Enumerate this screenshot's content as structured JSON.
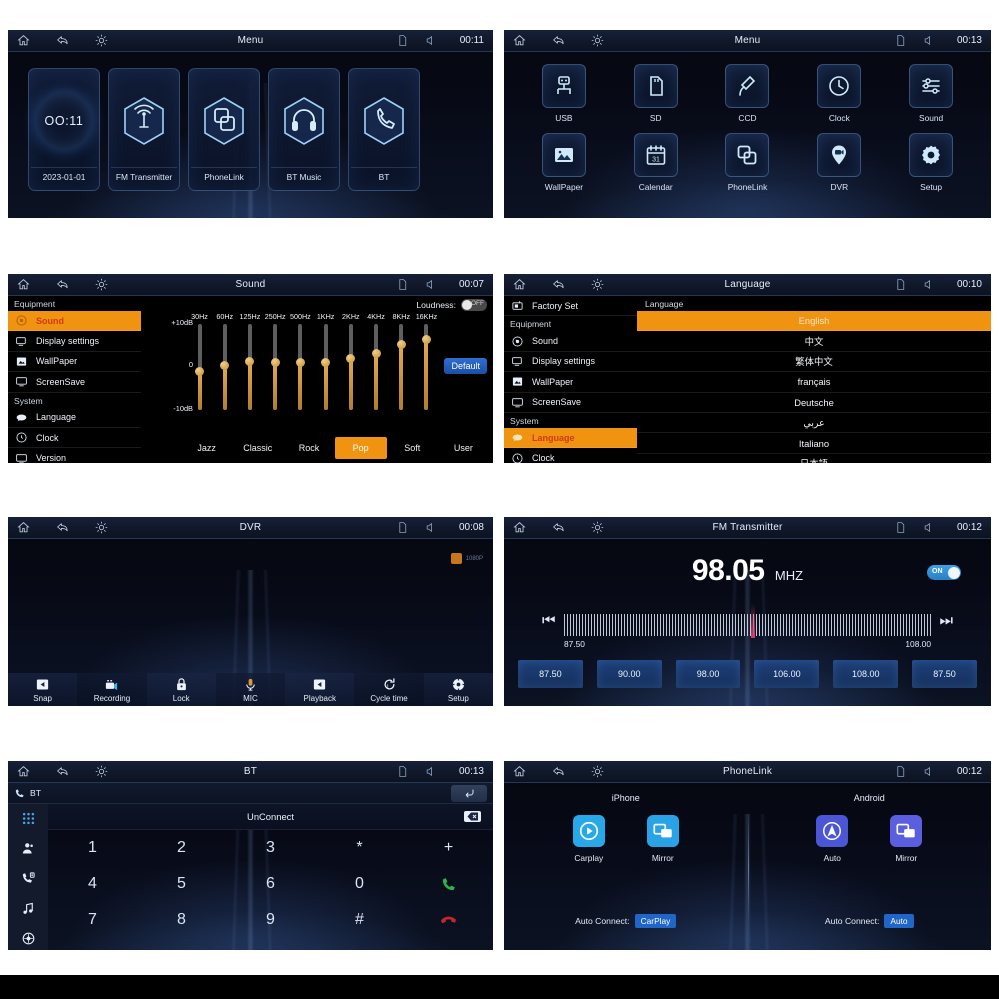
{
  "statusbar": {
    "icons": [
      "home-icon",
      "back-icon",
      "brightness-icon",
      "sd-card-icon",
      "mute-icon"
    ],
    "titles": {
      "menu1": "Menu",
      "menu2": "Menu",
      "sound": "Sound",
      "language": "Language",
      "dvr": "DVR",
      "fm": "FM Transmitter",
      "bt": "BT",
      "phonelink": "PhoneLink"
    },
    "times": {
      "menu1": "00:11",
      "menu2": "00:13",
      "sound": "00:07",
      "language": "00:10",
      "dvr": "00:08",
      "fm": "00:12",
      "bt": "00:13",
      "phonelink": "00:12"
    }
  },
  "menu_carousel": {
    "clock_time": "OO:11",
    "cards": [
      {
        "label": "2023-01-01",
        "icon": "clock-globe-icon"
      },
      {
        "label": "FM Transmitter",
        "icon": "antenna-icon"
      },
      {
        "label": "PhoneLink",
        "icon": "phonelink-icon"
      },
      {
        "label": "BT Music",
        "icon": "headphones-icon"
      },
      {
        "label": "BT",
        "icon": "phone-icon"
      }
    ]
  },
  "app_grid": {
    "apps": [
      {
        "label": "USB",
        "icon": "usb-icon"
      },
      {
        "label": "SD",
        "icon": "sd-card-icon"
      },
      {
        "label": "CCD",
        "icon": "camera-plug-icon"
      },
      {
        "label": "Clock",
        "icon": "clock-icon"
      },
      {
        "label": "Sound",
        "icon": "sliders-icon"
      },
      {
        "label": "WallPaper",
        "icon": "image-icon"
      },
      {
        "label": "Calendar",
        "icon": "calendar-icon"
      },
      {
        "label": "PhoneLink",
        "icon": "phonelink-icon"
      },
      {
        "label": "DVR",
        "icon": "location-camera-icon"
      },
      {
        "label": "Setup",
        "icon": "gear-icon"
      }
    ]
  },
  "settings_sidebar_sound": {
    "groups": [
      {
        "title": "Equipment",
        "items": [
          {
            "label": "Sound",
            "icon": "sound-icon",
            "active": true
          },
          {
            "label": "Display settings",
            "icon": "display-icon",
            "active": false
          },
          {
            "label": "WallPaper",
            "icon": "wallpaper-icon",
            "active": false
          },
          {
            "label": "ScreenSave",
            "icon": "screensave-icon",
            "active": false
          }
        ]
      },
      {
        "title": "System",
        "items": [
          {
            "label": "Language",
            "icon": "language-icon",
            "active": false
          },
          {
            "label": "Clock",
            "icon": "clock-icon",
            "active": false
          },
          {
            "label": "Version",
            "icon": "version-icon",
            "active": false
          }
        ]
      }
    ]
  },
  "settings_sidebar_language": {
    "top_item": {
      "label": "Factory Set",
      "icon": "factory-icon"
    },
    "groups": [
      {
        "title": "Equipment",
        "items": [
          {
            "label": "Sound",
            "icon": "sound-icon",
            "active": false
          },
          {
            "label": "Display settings",
            "icon": "display-icon",
            "active": false
          },
          {
            "label": "WallPaper",
            "icon": "wallpaper-icon",
            "active": false
          },
          {
            "label": "ScreenSave",
            "icon": "screensave-icon",
            "active": false
          }
        ]
      },
      {
        "title": "System",
        "items": [
          {
            "label": "Language",
            "icon": "language-icon",
            "active": true
          },
          {
            "label": "Clock",
            "icon": "clock-icon",
            "active": false
          }
        ]
      }
    ]
  },
  "equalizer": {
    "loudness_label": "Loudness:",
    "loudness_state": "OFF",
    "default_button": "Default",
    "scale": {
      "top": "+10dB",
      "mid": "0",
      "bottom": "-10dB"
    },
    "presets": [
      "Jazz",
      "Classic",
      "Rock",
      "Pop",
      "Soft",
      "User"
    ],
    "active_preset": "Pop",
    "bands": [
      {
        "hz": "30Hz",
        "db": -4
      },
      {
        "hz": "60Hz",
        "db": -1
      },
      {
        "hz": "125Hz",
        "db": 0
      },
      {
        "hz": "250Hz",
        "db": 0
      },
      {
        "hz": "500Hz",
        "db": 0
      },
      {
        "hz": "1KHz",
        "db": 0
      },
      {
        "hz": "2KHz",
        "db": 1
      },
      {
        "hz": "4KHz",
        "db": 2
      },
      {
        "hz": "8KHz",
        "db": 4
      },
      {
        "hz": "16KHz",
        "db": 5
      }
    ]
  },
  "language_panel": {
    "header": "Language",
    "options": [
      "English",
      "中文",
      "繁体中文",
      "français",
      "Deutsche",
      "عربي",
      "Italiano",
      "日本語"
    ],
    "selected": "English"
  },
  "dvr": {
    "badge_resolution": "1080P",
    "buttons": [
      {
        "label": "Snap",
        "icon": "snap-icon"
      },
      {
        "label": "Recording",
        "icon": "record-camera-icon"
      },
      {
        "label": "Lock",
        "icon": "lock-icon"
      },
      {
        "label": "MIC",
        "icon": "microphone-icon"
      },
      {
        "label": "Playback",
        "icon": "playback-icon"
      },
      {
        "label": "Cycle time",
        "icon": "cycle-time-icon"
      },
      {
        "label": "Setup",
        "icon": "gear-icon"
      }
    ]
  },
  "fm": {
    "frequency": "98.05",
    "unit": "MHZ",
    "toggle_state": "ON",
    "range_min": "87.50",
    "range_max": "108.00",
    "prev_icon": "skip-previous-icon",
    "next_icon": "skip-next-icon",
    "presets": [
      "87.50",
      "90.00",
      "98.00",
      "106.00",
      "108.00",
      "87.50"
    ]
  },
  "bt": {
    "sub_title": "BT",
    "sub_icon": "bt-phone-icon",
    "back_icon": "return-icon",
    "display_text": "UnConnect",
    "delete_icon": "backspace-icon",
    "rail_icons": [
      "keypad-icon",
      "contacts-icon",
      "call-log-icon",
      "music-note-icon",
      "settings-icon"
    ],
    "keys": [
      "1",
      "2",
      "3",
      "*",
      "+",
      "4",
      "5",
      "6",
      "0",
      "call-icon",
      "7",
      "8",
      "9",
      "#",
      "hangup-icon"
    ]
  },
  "phonelink": {
    "columns": [
      {
        "header": "iPhone",
        "apps": [
          {
            "label": "Carplay",
            "icon": "carplay-icon",
            "color": "#28a8e8"
          },
          {
            "label": "Mirror",
            "icon": "mirror-icon",
            "color": "#29a3e6"
          }
        ],
        "auto_label": "Auto Connect:",
        "auto_value": "CarPlay"
      },
      {
        "header": "Android",
        "apps": [
          {
            "label": "Auto",
            "icon": "android-auto-icon",
            "color": "#4a56d6"
          },
          {
            "label": "Mirror",
            "icon": "mirror-icon",
            "color": "#5a5fe0"
          }
        ],
        "auto_label": "Auto Connect:",
        "auto_value": "Auto"
      }
    ]
  },
  "colors": {
    "accent_orange": "#ef9310",
    "accent_blue": "#1f66c8",
    "panel_bg": "#05070f",
    "page_bg": "#ffffff"
  }
}
